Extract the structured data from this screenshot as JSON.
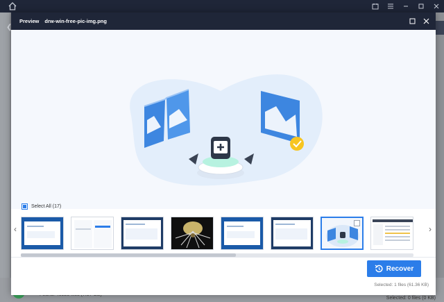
{
  "dialog": {
    "title": "Preview",
    "filename": "drw-win-free-pic-img.png"
  },
  "select_all": {
    "label": "Select All (17)"
  },
  "recover": {
    "label": "Recover"
  },
  "footer": {
    "selected": "Selected: 1 files (61.36 KB)"
  },
  "background": {
    "found": "Found: 46923 files (7.57 GB)",
    "selected": "Selected: 0 files (0 KB)"
  },
  "thumbnails": [
    {
      "kind": "blue-screen"
    },
    {
      "kind": "white-form"
    },
    {
      "kind": "dark-app"
    },
    {
      "kind": "dark-spider"
    },
    {
      "kind": "blue-screen"
    },
    {
      "kind": "dark-app"
    },
    {
      "kind": "illustration",
      "selected": true
    },
    {
      "kind": "file-list"
    }
  ],
  "colors": {
    "accent": "#2b7de9",
    "titlebar": "#1f2638",
    "preview_bg": "#f5f8fd"
  }
}
